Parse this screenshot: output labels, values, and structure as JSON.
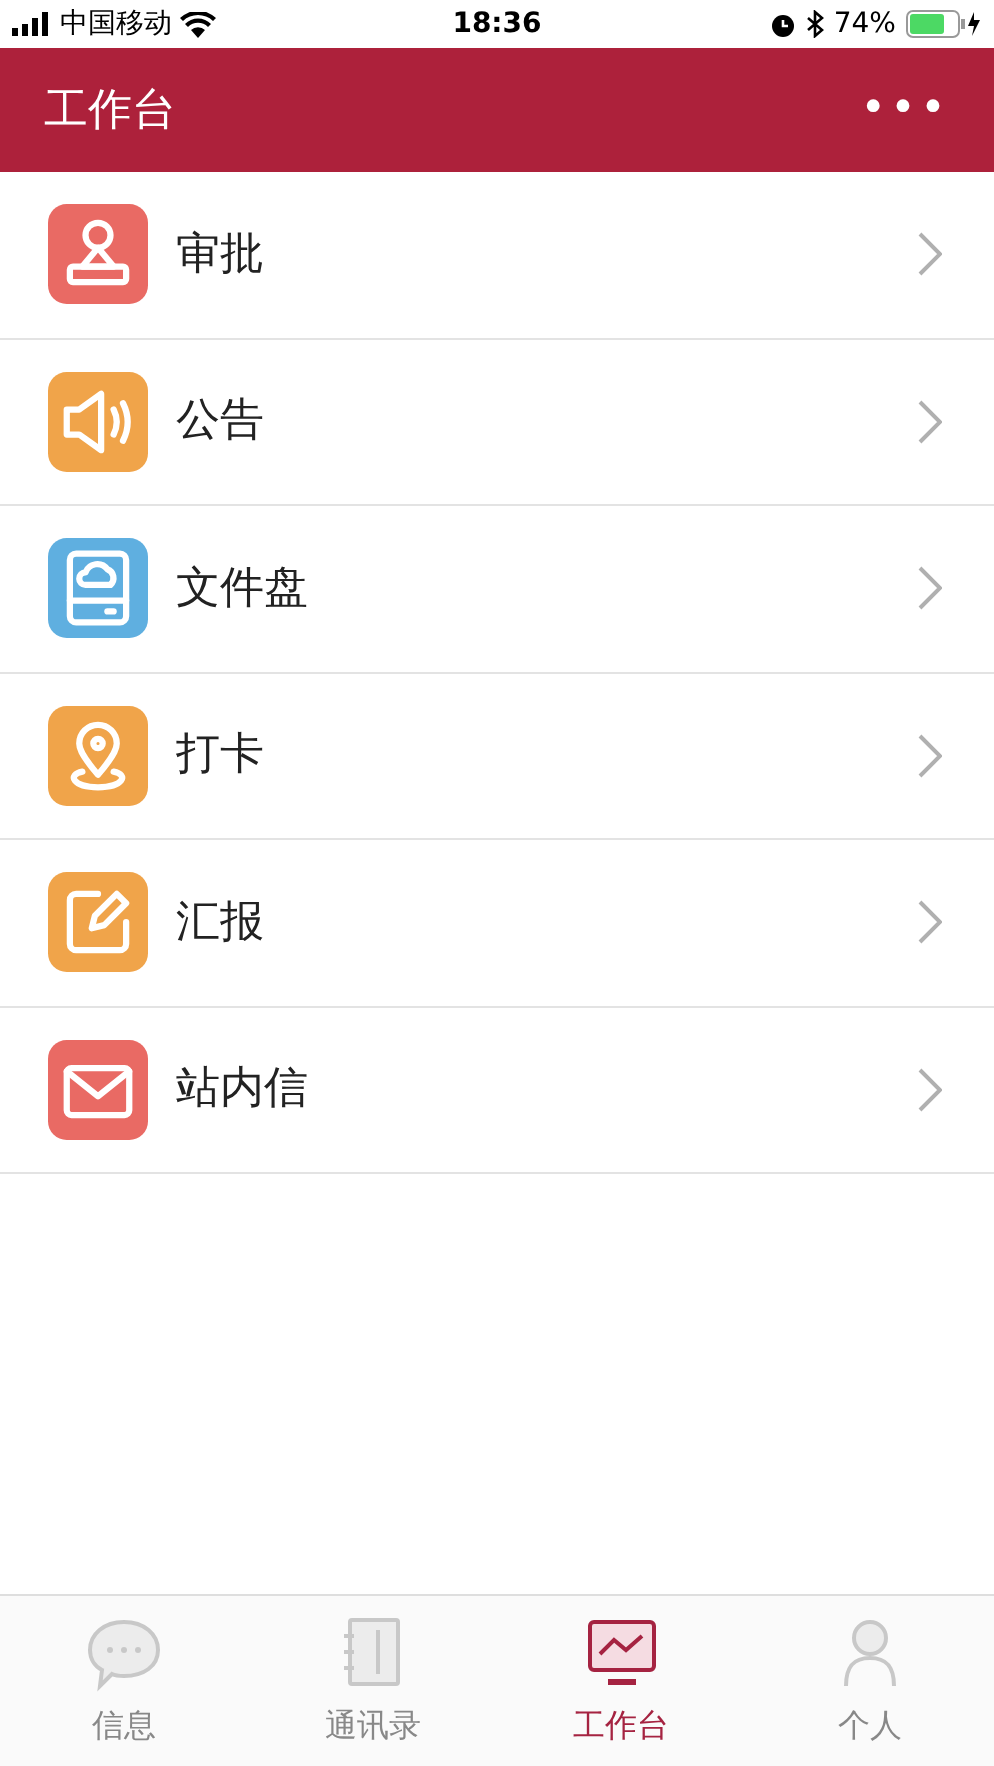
{
  "status_bar": {
    "carrier": "中国移动",
    "time": "18:36",
    "battery": "74%"
  },
  "header": {
    "title": "工作台",
    "menu": "•••"
  },
  "items": [
    {
      "label": "审批",
      "kind": "stamp",
      "color": "#e96a64"
    },
    {
      "label": "公告",
      "kind": "speaker",
      "color": "#f0a44a"
    },
    {
      "label": "文件盘",
      "kind": "drive",
      "color": "#5fafe0"
    },
    {
      "label": "打卡",
      "kind": "pin",
      "color": "#f0a44a"
    },
    {
      "label": "汇报",
      "kind": "edit",
      "color": "#f0a44a"
    },
    {
      "label": "站内信",
      "kind": "mail",
      "color": "#e96a64"
    }
  ],
  "tab_bar": [
    {
      "label": "信息",
      "kind": "chat",
      "selected": false
    },
    {
      "label": "通讯录",
      "kind": "book",
      "selected": false
    },
    {
      "label": "工作台",
      "kind": "monitor",
      "selected": true
    },
    {
      "label": "个人",
      "kind": "person",
      "selected": false
    }
  ]
}
